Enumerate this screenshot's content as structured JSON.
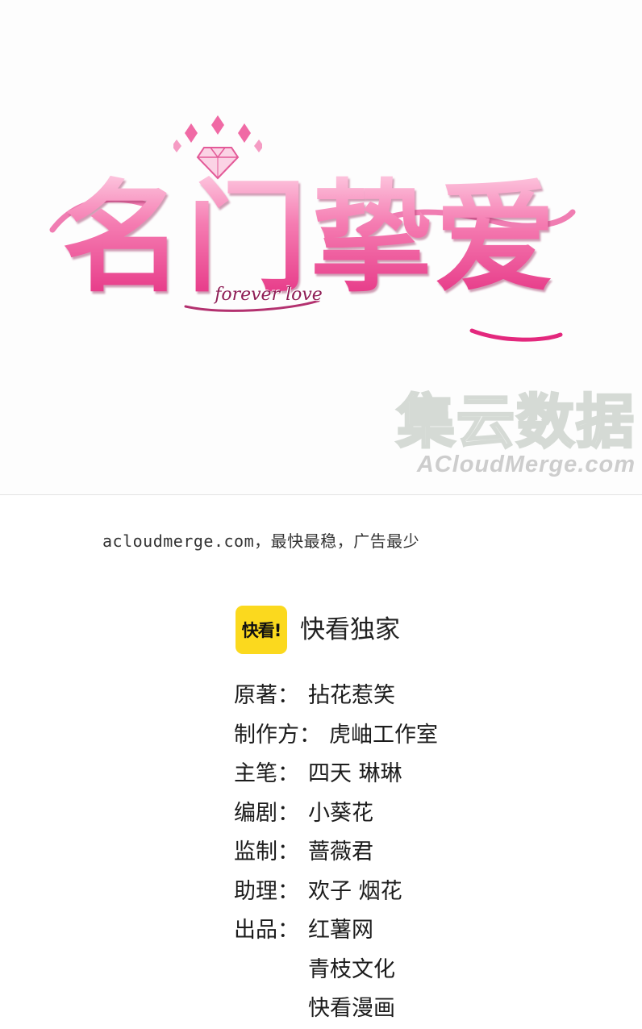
{
  "cover": {
    "title": "名门挚爱",
    "subtitle": "forever love",
    "watermark_cn": "集云数据",
    "watermark_en": "ACloudMerge.com",
    "colors": {
      "title_pink": "#e3287d",
      "title_light": "#ffd9ea"
    }
  },
  "promo": {
    "text": "acloudmerge.com，最快最稳，广告最少"
  },
  "brand": {
    "logo_text": "快看!",
    "label": "快看独家",
    "logo_color": "#fbd91e"
  },
  "credits": [
    {
      "label": "原著：",
      "value": "拈花惹笑"
    },
    {
      "label": "制作方：",
      "value": "虎岫工作室"
    },
    {
      "label": "主笔：",
      "value": "四天 琳琳"
    },
    {
      "label": "编剧：",
      "value": "小葵花"
    },
    {
      "label": "监制：",
      "value": "蔷薇君"
    },
    {
      "label": "助理：",
      "value": "欢子 烟花"
    },
    {
      "label": "出品：",
      "value": "红薯网"
    }
  ],
  "publishers_extra": [
    "青枝文化",
    "快看漫画"
  ]
}
